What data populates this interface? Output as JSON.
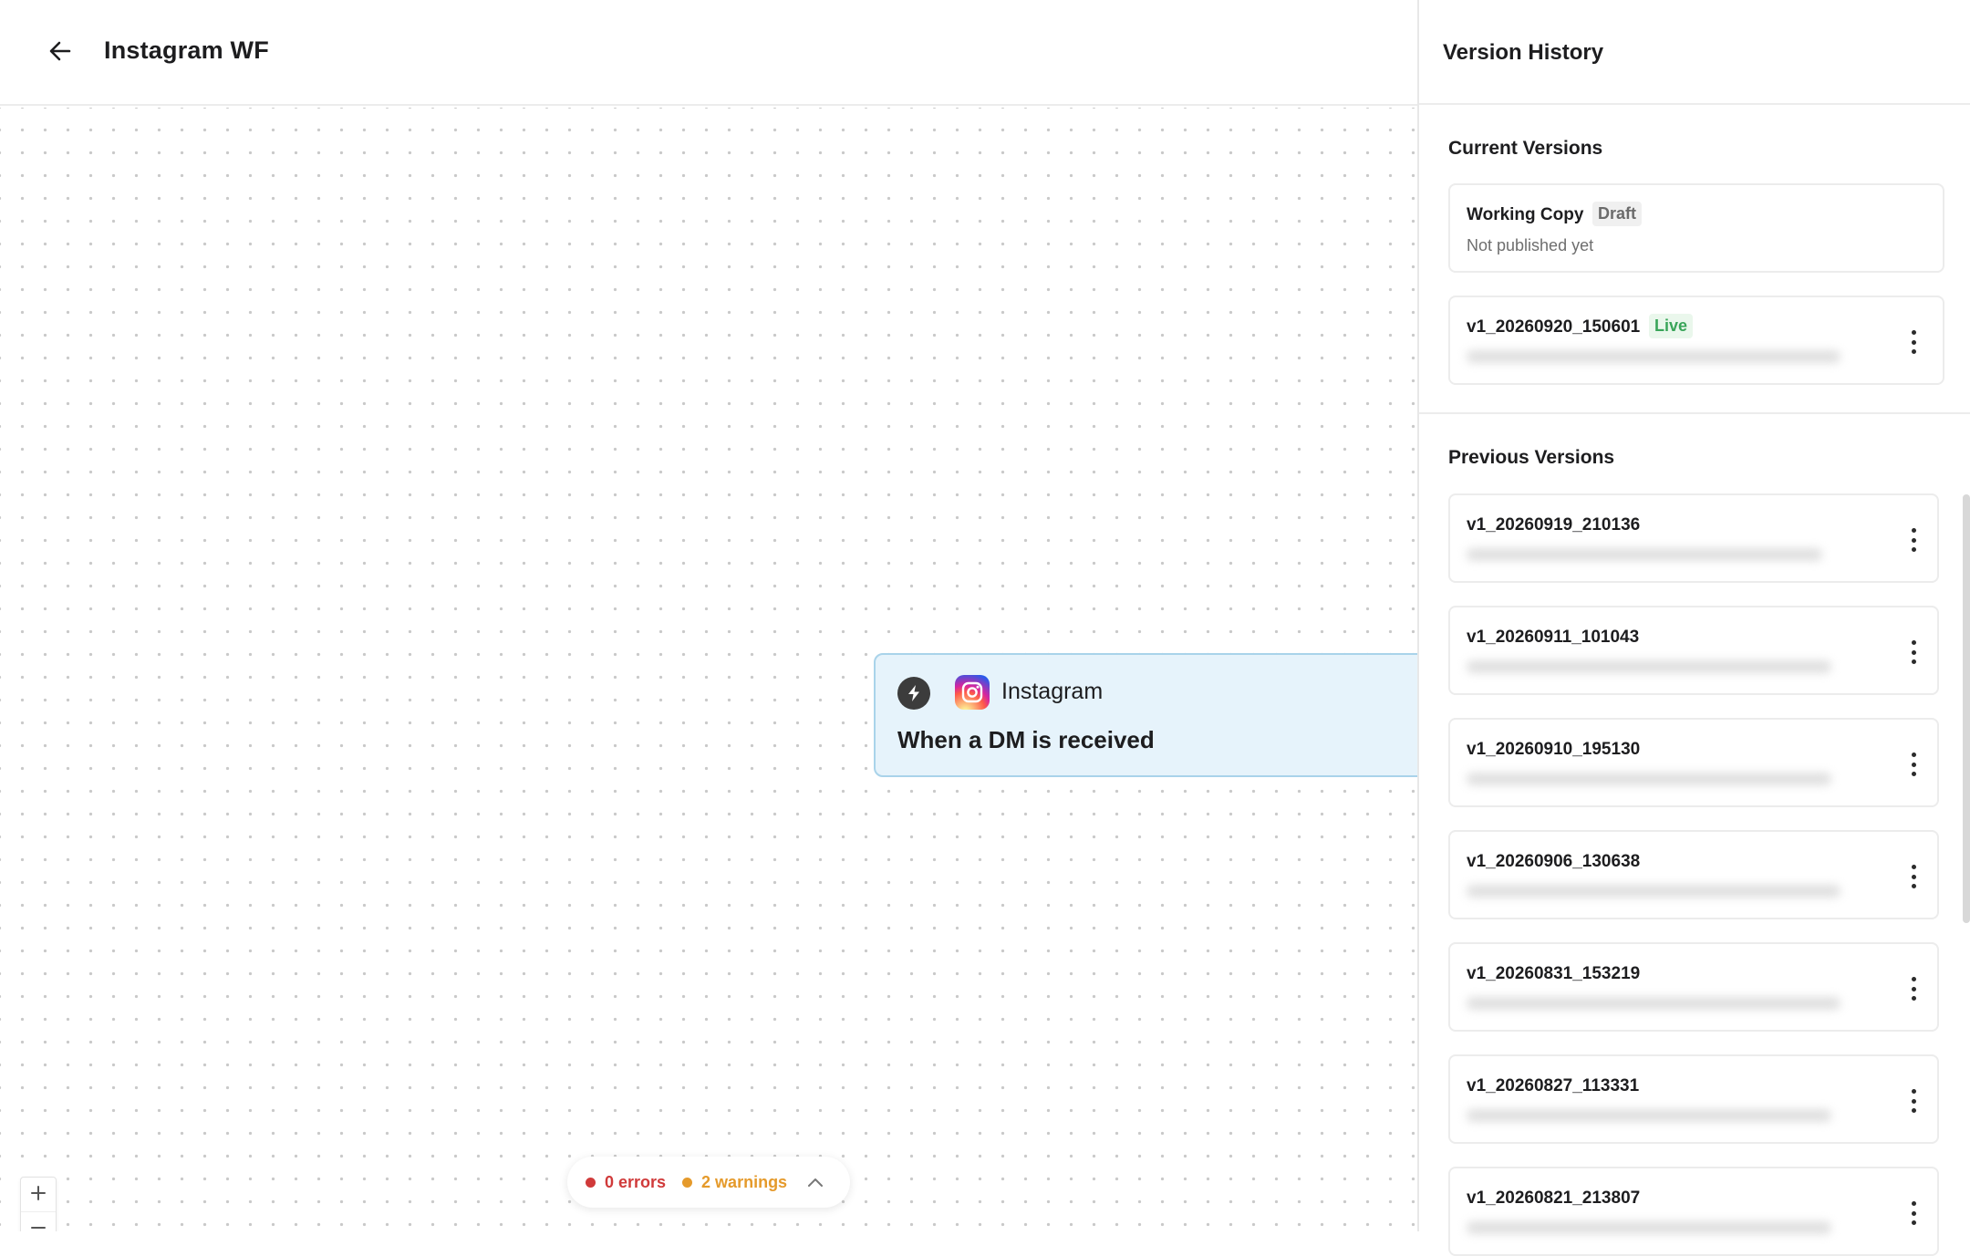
{
  "header": {
    "back_icon": "arrow-left-icon",
    "title": "Instagram WF"
  },
  "canvas": {
    "node": {
      "app_name": "Instagram",
      "trigger_title": "When a DM is received",
      "trigger_icon": "bolt-icon",
      "app_icon": "instagram-icon"
    },
    "controls": {
      "zoom_in_icon": "plus-icon",
      "zoom_out_icon": "minus-icon",
      "fit_view_icon": "fit-view-icon",
      "lock_icon": "lock-icon"
    },
    "status": {
      "errors": "0 errors",
      "warnings": "2 warnings",
      "error_color": "#d03a3a",
      "warning_color": "#e59a2b",
      "toggle_icon": "chevron-up-icon"
    }
  },
  "version_panel": {
    "title": "Version History",
    "current_section": "Current Versions",
    "previous_section": "Previous Versions",
    "current_versions": [
      {
        "name": "Working Copy",
        "badge": "Draft",
        "subtitle": "Not published yet"
      },
      {
        "name": "v1_20260920_150601",
        "badge": "Live"
      }
    ],
    "previous_versions": [
      {
        "name": "v1_20260919_210136"
      },
      {
        "name": "v1_20260911_101043"
      },
      {
        "name": "v1_20260910_195130"
      },
      {
        "name": "v1_20260906_130638"
      },
      {
        "name": "v1_20260831_153219"
      },
      {
        "name": "v1_20260827_113331"
      },
      {
        "name": "v1_20260821_213807"
      }
    ],
    "colors": {
      "live_badge": "#39a559",
      "draft_badge": "#6b6b6b"
    }
  }
}
